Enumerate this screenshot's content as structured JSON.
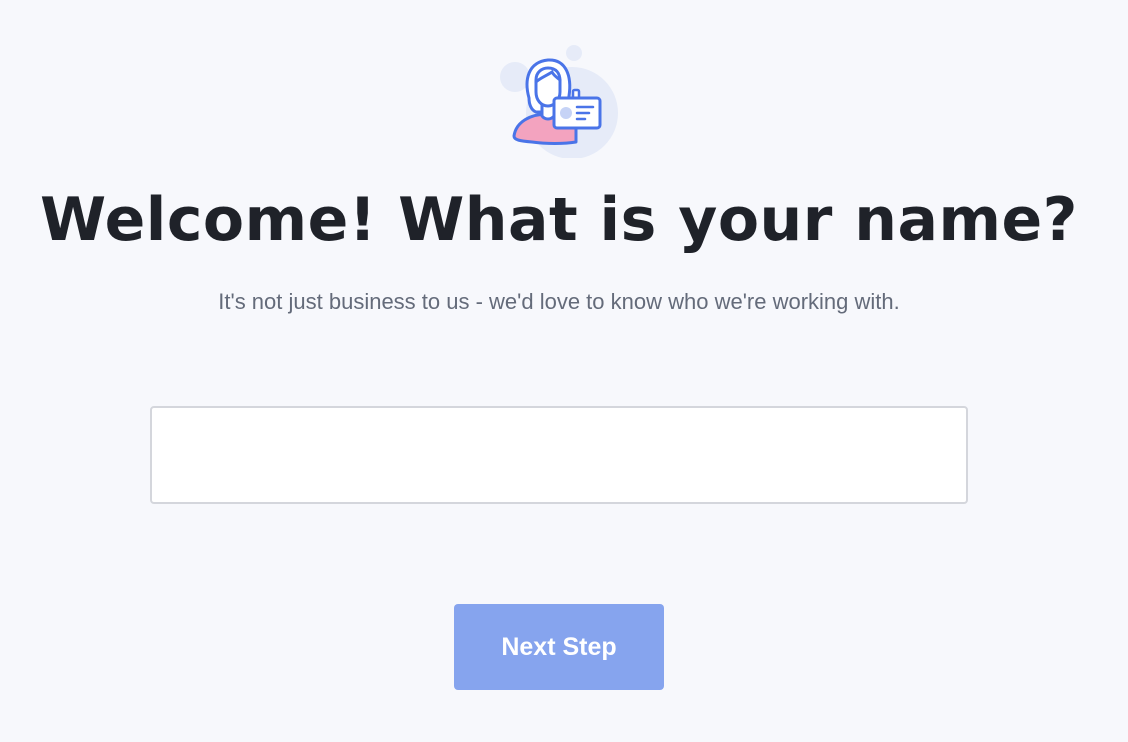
{
  "illustration": {
    "icon": "person-with-id-badge-icon",
    "colors": {
      "outline": "#4a74e8",
      "blob": "#e2e8f8",
      "shirt": "#f3a3bf",
      "face_fill": "#ffffff"
    }
  },
  "heading": {
    "title": "Welcome! What is your name?",
    "subtitle": "It's not just business to us - we'd love to know who we're working with."
  },
  "form": {
    "name_input": {
      "value": "",
      "placeholder": ""
    },
    "next_button_label": "Next Step"
  },
  "colors": {
    "background": "#f7f8fc",
    "title": "#1f2229",
    "subtitle": "#646b7a",
    "button": "#86a4ee",
    "input_border": "#d4d6dc"
  }
}
